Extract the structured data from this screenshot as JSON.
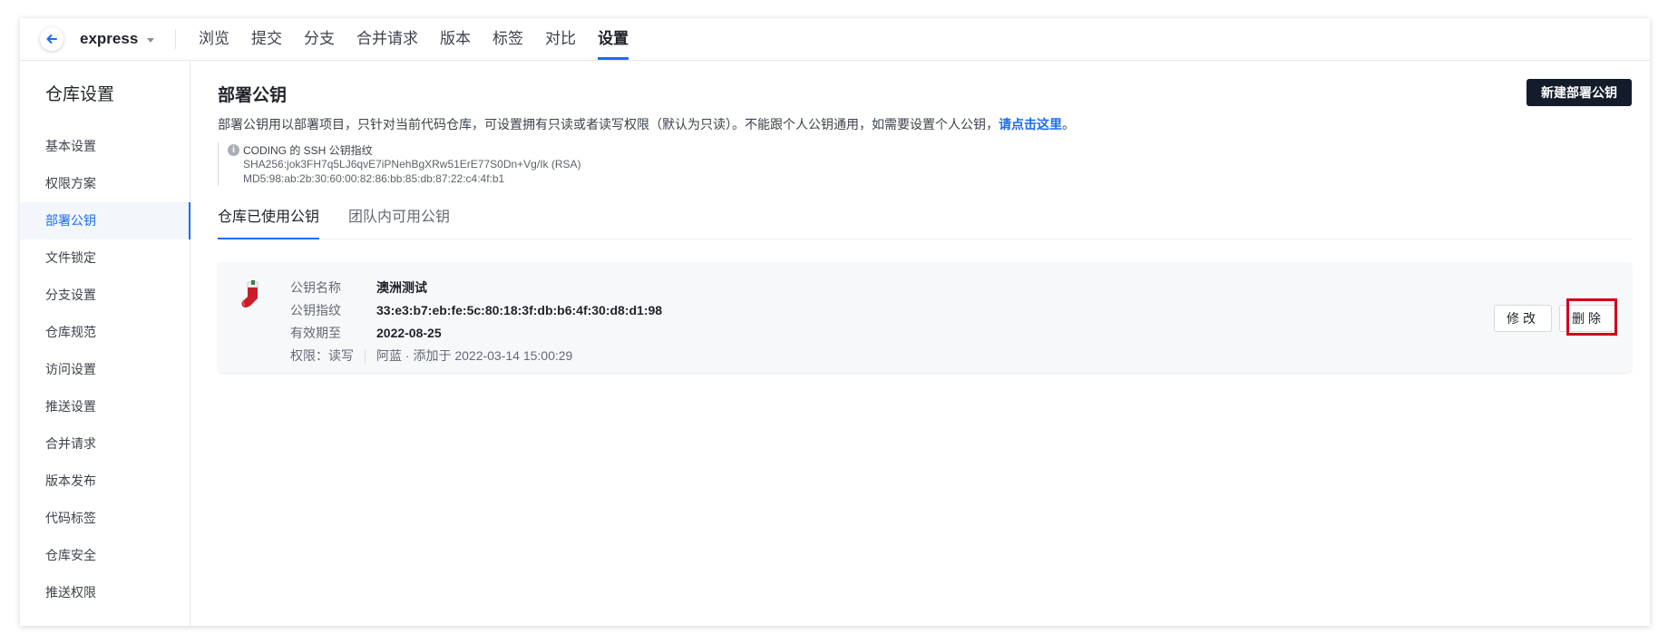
{
  "topnav": {
    "repo_name": "express",
    "tabs": [
      "浏览",
      "提交",
      "分支",
      "合并请求",
      "版本",
      "标签",
      "对比",
      "设置"
    ],
    "active_tab": "设置"
  },
  "sidebar": {
    "title": "仓库设置",
    "items": [
      "基本设置",
      "权限方案",
      "部署公钥",
      "文件锁定",
      "分支设置",
      "仓库规范",
      "访问设置",
      "推送设置",
      "合并请求",
      "版本发布",
      "代码标签",
      "仓库安全",
      "推送权限"
    ],
    "active_item": "部署公钥"
  },
  "main": {
    "title": "部署公钥",
    "new_button": "新建部署公钥",
    "description": "部署公钥用以部署项目，只针对当前代码仓库，可设置拥有只读或者读写权限（默认为只读）。不能跟个人公钥通用，如需要设置个人公钥，",
    "description_link": "请点击这里",
    "description_end": "。",
    "fingerprint": {
      "heading": "CODING 的 SSH 公钥指纹",
      "sha256": "SHA256:jok3FH7q5LJ6qvE7iPNehBgXRw51ErE77S0Dn+Vg/Ik (RSA)",
      "md5": "MD5:98:ab:2b:30:60:00:82:86:bb:85:db:87:22:c4:4f:b1"
    },
    "key_tabs": [
      "仓库已使用公钥",
      "团队内可用公钥"
    ],
    "key_card": {
      "name_label": "公钥名称",
      "name": "澳洲测试",
      "fingerprint_label": "公钥指纹",
      "fingerprint": "33:e3:b7:eb:fe:5c:80:18:3f:db:b6:4f:30:d8:d1:98",
      "expiry_label": "有效期至",
      "expiry": "2022-08-25",
      "permission": "权限：读写",
      "added_by": "阿蓝 · 添加于 2022-03-14 15:00:29",
      "edit_button": "修改",
      "delete_button": "删除"
    }
  },
  "colors": {
    "accent": "#1b6cf2",
    "highlight": "#d0021b",
    "primary_button": "#141c2b"
  }
}
